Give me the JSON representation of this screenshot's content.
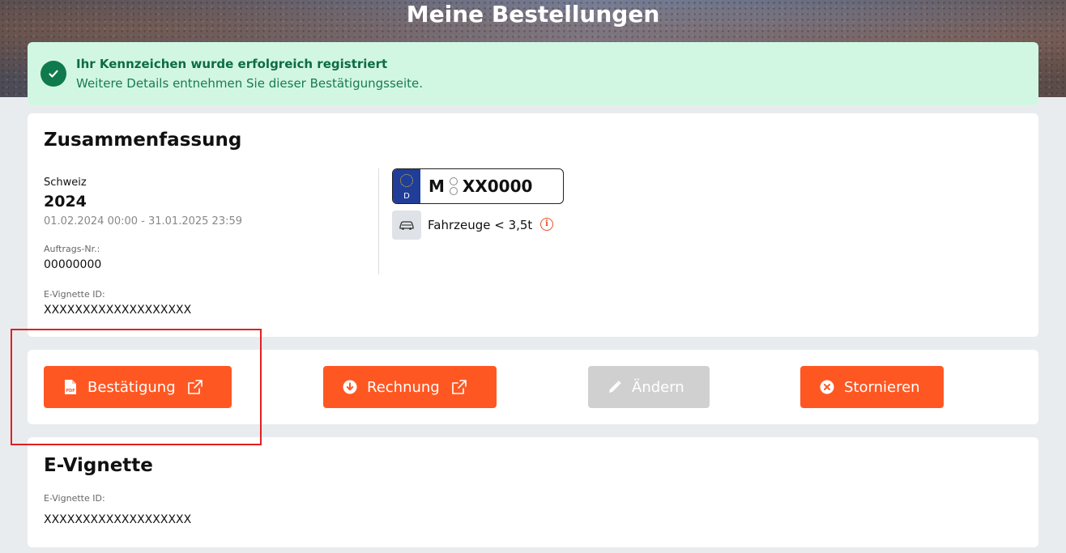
{
  "page": {
    "title": "Meine Bestellungen"
  },
  "alert": {
    "title": "Ihr Kennzeichen wurde erfolgreich registriert",
    "text": "Weitere Details entnehmen Sie dieser Bestätigungsseite.",
    "icon": "check-circle-icon",
    "color": "#0f7a4c"
  },
  "summary": {
    "heading": "Zusammenfassung",
    "country": "Schweiz",
    "year": "2024",
    "period": "01.02.2024 00:00 - 31.01.2025 23:59",
    "order_label": "Auftrags-Nr.:",
    "order_number": "00000000",
    "vignette_label": "E-Vignette ID:",
    "vignette_id": "XXXXXXXXXXXXXXXXXXX",
    "plate": {
      "country_code": "D",
      "prefix": "M",
      "number": "XX0000"
    },
    "vehicle": {
      "icon": "car-icon",
      "label": "Fahrzeuge < 3,5t",
      "info_icon": "info-icon"
    }
  },
  "actions": {
    "confirmation": {
      "label": "Bestätigung",
      "icon": "pdf-icon",
      "ext_icon": "external-link-icon"
    },
    "invoice": {
      "label": "Rechnung",
      "icon": "download-icon",
      "ext_icon": "external-link-icon"
    },
    "edit": {
      "label": "Ändern",
      "icon": "pencil-icon",
      "disabled": true
    },
    "cancel": {
      "label": "Stornieren",
      "icon": "x-circle-icon"
    }
  },
  "evignette": {
    "heading": "E-Vignette",
    "id_label": "E-Vignette ID:",
    "id_value": "XXXXXXXXXXXXXXXXXXX"
  },
  "colors": {
    "accent": "#ff5722",
    "disabled": "#d0d0d0",
    "success_bg": "#d1f7e3",
    "highlight": "#e02020"
  }
}
